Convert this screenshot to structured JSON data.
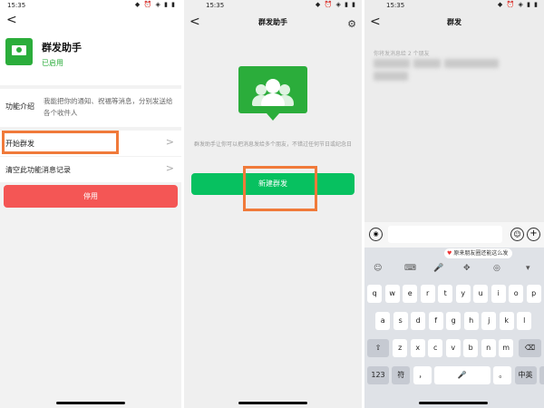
{
  "status": {
    "time": "15:35",
    "icons": "◆ ⏰ ◈ ▮ ▮"
  },
  "panel1": {
    "back": "<",
    "title": "群发助手",
    "status": "已启用",
    "intro_label": "功能介绍",
    "intro_text": "我能把你的通知、祝福等消息，分别发送给各个收件人",
    "menu": [
      {
        "label": "开始群发",
        "chevron": ">"
      },
      {
        "label": "清空此功能消息记录",
        "chevron": ">"
      }
    ],
    "stop_label": "停用",
    "colors": {
      "accent": "#2bad3b",
      "danger": "#f45655",
      "highlight": "#f07a3a"
    }
  },
  "panel2": {
    "back": "<",
    "title": "群发助手",
    "gear": "⚙",
    "description": "群发助手让你可以把消息发给多个朋友，不错过任何节日或纪念日",
    "new_button": "新建群发",
    "colors": {
      "button": "#07c160"
    }
  },
  "panel3": {
    "back": "<",
    "title": "群发",
    "recipients": "你将发消息给 2 个朋友",
    "voice_icon": "◉",
    "emoji_icon": "☺",
    "plus_icon": "+",
    "suggestion": "原来朋友圈还能这么发",
    "suggestion_mark": "♥",
    "toolbar": [
      "☺",
      "⌨",
      "🎤",
      "✥",
      "◎",
      "▾"
    ],
    "rows": [
      [
        "q",
        "w",
        "e",
        "r",
        "t",
        "y",
        "u",
        "i",
        "o",
        "p"
      ],
      [
        "a",
        "s",
        "d",
        "f",
        "g",
        "h",
        "j",
        "k",
        "l"
      ],
      [
        "⇧",
        "z",
        "x",
        "c",
        "v",
        "b",
        "n",
        "m",
        "⌫"
      ],
      [
        "123",
        "符",
        "，",
        "🎤",
        "。",
        "中英",
        "↵"
      ]
    ]
  }
}
